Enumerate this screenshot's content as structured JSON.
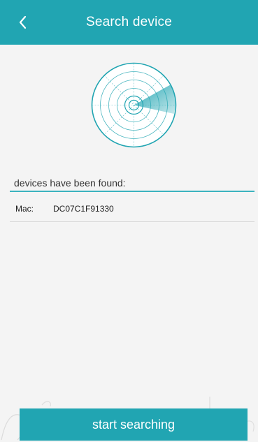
{
  "header": {
    "back_icon": "chevron-left-icon",
    "title": "Search device"
  },
  "radar": {
    "icon": "radar-icon",
    "color": "#21a5b2"
  },
  "results": {
    "heading": "devices have been found:",
    "devices": [
      {
        "label": "Mac:",
        "value": "DC07C1F91330"
      }
    ]
  },
  "footer": {
    "button_label": "start searching"
  },
  "colors": {
    "accent": "#21a5b2",
    "background": "#f4f4f4"
  }
}
